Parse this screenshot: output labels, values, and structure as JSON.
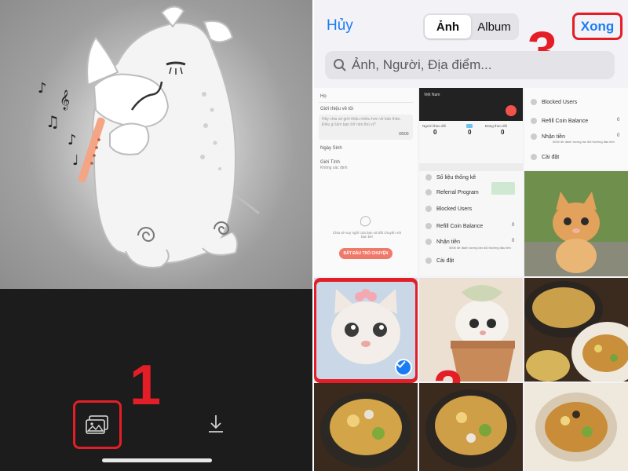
{
  "left_panel": {
    "gallery_icon": "photo-gallery-icon",
    "download_icon": "download-icon",
    "step_label": "1"
  },
  "picker": {
    "cancel_label": "Hủy",
    "tabs": [
      {
        "label": "Ảnh",
        "active": true
      },
      {
        "label": "Album",
        "active": false
      }
    ],
    "done_label": "Xong",
    "search_placeholder": "Ảnh, Người, Địa điểm...",
    "step_done": "3",
    "step_select": "2"
  },
  "screenshot_profile": {
    "field_ho": "Họ",
    "field_intro": "Giới thiệu về tôi",
    "intro_placeholder": "Hãy chia sẻ giới thiệu nhiều hơn về bản thân. Điều gì làm bạn trở nên thú vị?",
    "intro_count": "0/500",
    "field_birthday": "Ngày Sinh",
    "field_gender": "Giới Tính",
    "gender_value": "Không xác định",
    "empty_text": "Chia sẻ suy nghĩ của bạn và bắt chuyện với bạn bè!",
    "start_button": "BẮT ĐẦU TRÒ CHUYỆN"
  },
  "screenshot_wallet": {
    "username": "Việt Nam",
    "stats": [
      {
        "label": "Người theo dõi",
        "value": "0"
      },
      {
        "label": "",
        "value": "0"
      },
      {
        "label": "Đang theo dõi",
        "value": "0"
      }
    ],
    "menu": [
      "Số liệu thống kê",
      "Referral Program",
      "Blocked Users",
      "Refill Coin Balance",
      "Nhận tiền",
      "Cài đặt"
    ],
    "refill_value": "0",
    "earn_value": "0",
    "earn_note": "5000 đề đánh tương lần đối thưởng đầu tiên"
  },
  "screenshot_menu_top": {
    "menu": [
      "Blocked Users",
      "Refill Coin Balance",
      "Nhận tiền",
      "Cài đặt"
    ],
    "refill_value": "0",
    "earn_value": "0",
    "earn_note": "5000 đề đánh tương lần đối thưởng đầu tiên"
  },
  "selection": {
    "selected_index": 4,
    "check_icon": "checkmark-icon"
  }
}
